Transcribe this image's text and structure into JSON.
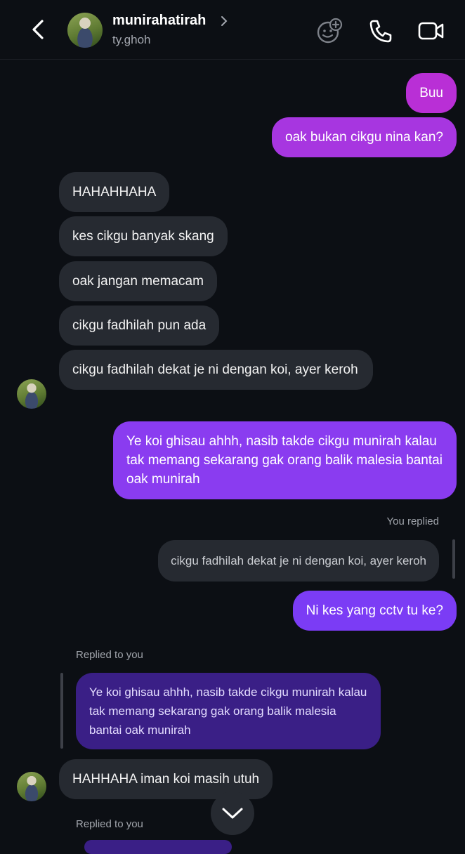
{
  "header": {
    "display_name": "munirahatirah",
    "username": "ty.ghoh",
    "icons": [
      "back-icon",
      "chevron-right-icon",
      "add-emoji-icon",
      "phone-icon",
      "video-icon"
    ]
  },
  "messages": {
    "m1": "Buu",
    "m2": "oak bukan cikgu nina kan?",
    "m3": "HAHAHHAHA",
    "m4": "kes cikgu banyak skang",
    "m5": "oak jangan memacam",
    "m6": "cikgu fadhilah pun ada",
    "m7": "cikgu fadhilah dekat je ni dengan koi, ayer keroh",
    "m8": "Ye koi ghisau ahhh, nasib takde cikgu munirah kalau tak memang sekarang gak orang balik malesia bantai oak munirah",
    "you_replied_label": "You replied",
    "quote1": "cikgu fadhilah dekat je ni dengan koi, ayer keroh",
    "m9": "Ni kes yang cctv tu ke?",
    "replied_to_you_label": "Replied to you",
    "quote2": "Ye koi ghisau ahhh, nasib takde cikgu munirah kalau tak memang sekarang gak orang balik malesia bantai oak munirah",
    "m10": "HAHHAHA iman koi masih utuh",
    "replied_to_you_label_2": "Replied to you"
  },
  "colors": {
    "background": "#0c0f14",
    "incoming_bubble": "#262a31",
    "outgoing_top": "#b92fd6",
    "outgoing_mid": "#8a3cf0",
    "outgoing_bottom": "#7b3cf5",
    "quoted_outgoing": "#3a1f86"
  }
}
